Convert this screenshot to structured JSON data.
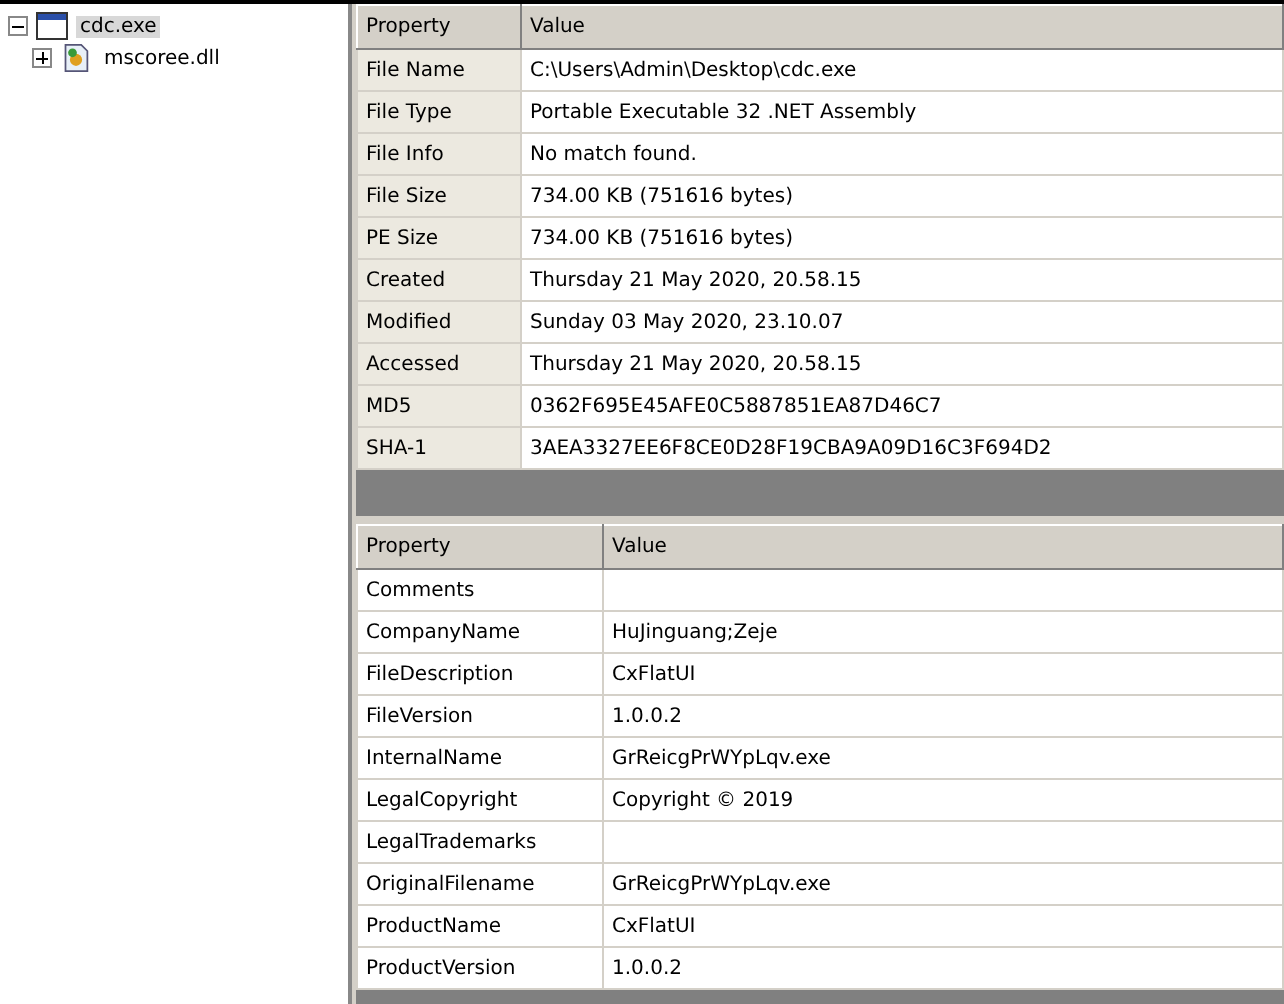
{
  "tree": [
    {
      "label": "cdc.exe",
      "selected": true,
      "expanded": true,
      "kind": "exe",
      "children": [
        {
          "label": "mscoree.dll",
          "selected": false,
          "expanded": false,
          "kind": "dll"
        }
      ]
    }
  ],
  "file_table": {
    "columns": [
      "Property",
      "Value"
    ],
    "rows": [
      [
        "File Name",
        "C:\\Users\\Admin\\Desktop\\cdc.exe"
      ],
      [
        "File Type",
        "Portable Executable 32 .NET Assembly"
      ],
      [
        "File Info",
        "No match found."
      ],
      [
        "File Size",
        "734.00 KB (751616 bytes)"
      ],
      [
        "PE Size",
        "734.00 KB (751616 bytes)"
      ],
      [
        "Created",
        "Thursday 21 May 2020, 20.58.15"
      ],
      [
        "Modified",
        "Sunday 03 May 2020, 23.10.07"
      ],
      [
        "Accessed",
        "Thursday 21 May 2020, 20.58.15"
      ],
      [
        "MD5",
        "0362F695E45AFE0C5887851EA87D46C7"
      ],
      [
        "SHA-1",
        "3AEA3327EE6F8CE0D28F19CBA9A09D16C3F694D2"
      ]
    ]
  },
  "version_table": {
    "columns": [
      "Property",
      "Value"
    ],
    "rows": [
      [
        "Comments",
        ""
      ],
      [
        "CompanyName",
        "HuJinguang;Zeje"
      ],
      [
        "FileDescription",
        "CxFlatUI"
      ],
      [
        "FileVersion",
        "1.0.0.2"
      ],
      [
        "InternalName",
        "GrReicgPrWYpLqv.exe"
      ],
      [
        "LegalCopyright",
        "Copyright © 2019"
      ],
      [
        "LegalTrademarks",
        ""
      ],
      [
        "OriginalFilename",
        "GrReicgPrWYpLqv.exe"
      ],
      [
        "ProductName",
        "CxFlatUI"
      ],
      [
        "ProductVersion",
        "1.0.0.2"
      ]
    ]
  }
}
